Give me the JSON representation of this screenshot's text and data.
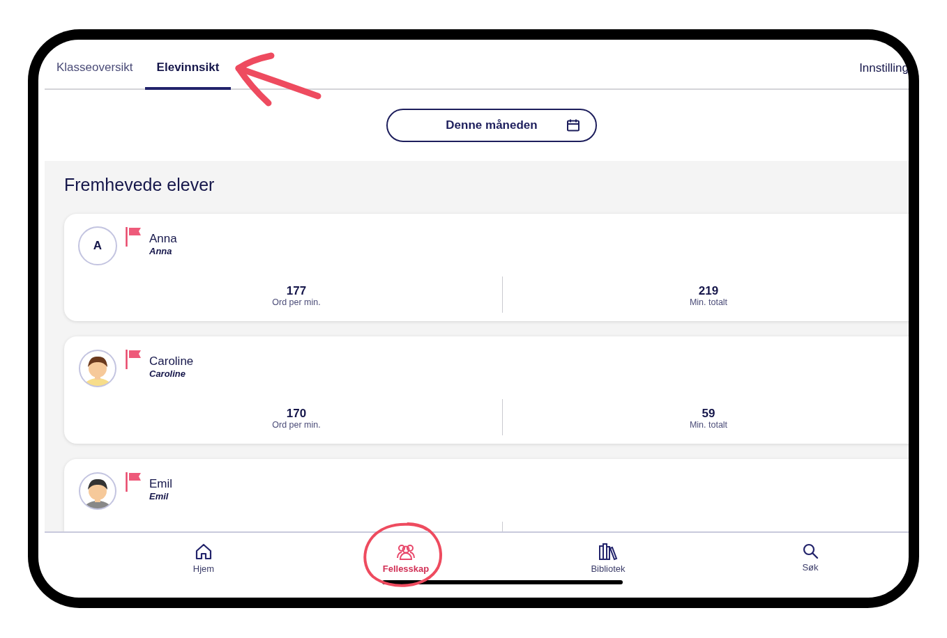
{
  "tabs": [
    {
      "label": "Klasseoversikt",
      "selected": false
    },
    {
      "label": "Elevinnsikt",
      "selected": true
    }
  ],
  "settings_link": "Innstilling",
  "period_button": {
    "label": "Denne måneden"
  },
  "section": {
    "title": "Fremhevede elever"
  },
  "students": [
    {
      "name": "Anna",
      "username": "Anna",
      "avatar": {
        "kind": "initial",
        "text": "A"
      },
      "flagged": true,
      "stats": [
        {
          "value": "177",
          "label": "Ord per min."
        },
        {
          "value": "219",
          "label": "Min. totalt"
        }
      ]
    },
    {
      "name": "Caroline",
      "username": "Caroline",
      "avatar": {
        "kind": "picture"
      },
      "flagged": true,
      "stats": [
        {
          "value": "170",
          "label": "Ord per min."
        },
        {
          "value": "59",
          "label": "Min. totalt"
        }
      ]
    },
    {
      "name": "Emil",
      "username": "Emil",
      "avatar": {
        "kind": "picture"
      },
      "flagged": true
    }
  ],
  "bottom_nav": [
    {
      "label": "Hjem",
      "kind": "home",
      "selected": false
    },
    {
      "label": "Fellesskap",
      "kind": "community",
      "selected": true
    },
    {
      "label": "Bibliotek",
      "kind": "library",
      "selected": false
    },
    {
      "label": "Søk",
      "kind": "search",
      "selected": false
    }
  ]
}
